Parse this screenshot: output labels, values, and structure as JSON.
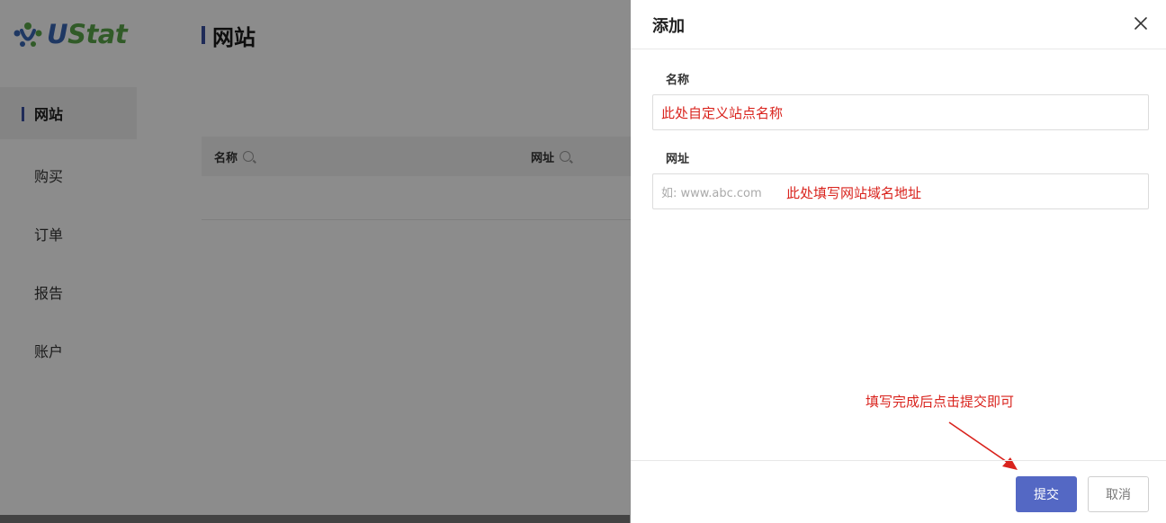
{
  "app": {
    "logo_u": "U",
    "logo_rest": "Stat",
    "page_title": "网站",
    "nav": [
      {
        "label": "网站",
        "active": true
      },
      {
        "label": "购买",
        "active": false
      },
      {
        "label": "订单",
        "active": false
      },
      {
        "label": "报告",
        "active": false
      },
      {
        "label": "账户",
        "active": false
      }
    ],
    "table": {
      "columns": [
        "名称",
        "网址"
      ]
    }
  },
  "drawer": {
    "title": "添加",
    "fields": {
      "name": {
        "label": "名称",
        "value": "此处自定义站点名称"
      },
      "url": {
        "label": "网址",
        "placeholder": "如: www.abc.com",
        "note": "此处填写网站域名地址"
      }
    },
    "hint": "填写完成后点击提交即可",
    "submit_label": "提交",
    "cancel_label": "取消"
  },
  "colors": {
    "accent": "#5468c4",
    "annotation": "#d9231d",
    "logo_blue": "#3a66b5",
    "logo_green": "#5aa64a"
  },
  "icons": {
    "close": "close-icon",
    "search": "search-icon",
    "logo": "logo-icon"
  }
}
